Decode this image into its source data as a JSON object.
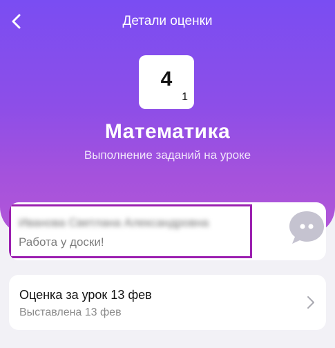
{
  "header": {
    "title": "Детали оценки",
    "back_icon": "chevron-left-icon"
  },
  "grade": {
    "value": "4",
    "weight": "1"
  },
  "subject": {
    "name": "Математика",
    "work_type": "Выполнение заданий на уроке"
  },
  "comment": {
    "teacher_name": "Иванова Светлана Александровна",
    "text": "Работа у доски!",
    "icon": "chat-bubble-icon",
    "highlight_color": "#9b1fb0"
  },
  "lesson": {
    "title": "Оценка за урок 13 фев",
    "date": "Выставлена 13 фев",
    "icon": "chevron-right-icon"
  },
  "colors": {
    "gradient_top": "#7a4df2",
    "gradient_bottom": "#b257d8",
    "background": "#f2f1f6"
  }
}
